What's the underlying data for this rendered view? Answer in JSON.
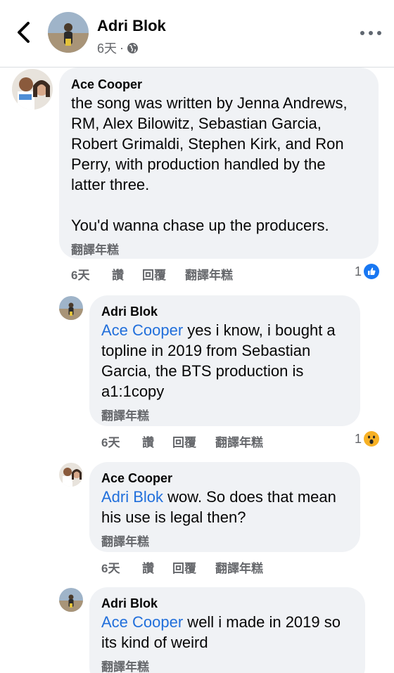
{
  "header": {
    "name": "Adri Blok",
    "time": "6天"
  },
  "comments": [
    {
      "author": "Ace Cooper",
      "lines": [
        "the song was written by Jenna Andrews,",
        "RM, Alex Bilowitz, Sebastian Garcia,",
        "Robert Grimaldi, Stephen Kirk, and Ron",
        "Perry, with production handled by the",
        "latter three."
      ],
      "line2": "You'd wanna chase up the producers.",
      "translate": "翻譯年糕",
      "time": "6天",
      "like": "讚",
      "reply": "回覆",
      "translate_action": "翻譯年糕",
      "reaction_count": "1",
      "reaction_type": "like-icon"
    },
    {
      "author": "Adri Blok",
      "mention": "Ace Cooper",
      "lines": [
        " yes i know, i bought a",
        "topline in 2019 from Sebastian",
        "Garcia, the BTS production is",
        "a1:1copy"
      ],
      "translate": "翻譯年糕",
      "time": "6天",
      "like": "讚",
      "reply": "回覆",
      "translate_action": "翻譯年糕",
      "reaction_count": "1",
      "reaction_type": "wow-icon"
    },
    {
      "author": "Ace Cooper",
      "mention": "Adri Blok",
      "lines": [
        " wow. So does that mean",
        "his use is legal then?"
      ],
      "translate": "翻譯年糕",
      "time": "6天",
      "like": "讚",
      "reply": "回覆",
      "translate_action": "翻譯年糕"
    },
    {
      "author": "Adri Blok",
      "mention": "Ace Cooper",
      "lines": [
        " well i made in 2019 so",
        "its kind of weird"
      ],
      "translate": "翻譯年糕"
    }
  ],
  "colors": {
    "mention": "#216fdb",
    "bubble": "#f0f2f5",
    "secondary_text": "#65676b",
    "like_blue": "#1877f2"
  }
}
